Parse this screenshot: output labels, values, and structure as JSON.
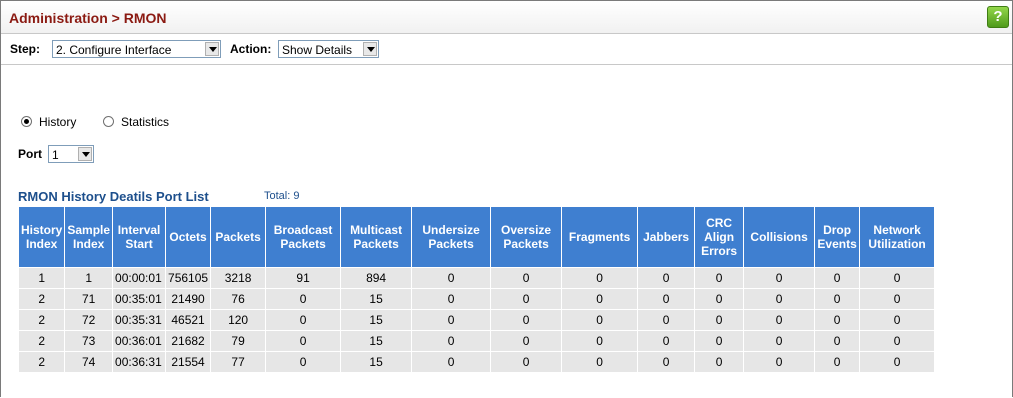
{
  "header": {
    "title": "Administration > RMON",
    "help_icon": "?"
  },
  "toolbar": {
    "step_label": "Step:",
    "step_value": "2. Configure Interface",
    "action_label": "Action:",
    "action_value": "Show Details"
  },
  "options": {
    "history_label": "History",
    "statistics_label": "Statistics",
    "selected": "History",
    "port_label": "Port",
    "port_value": "1"
  },
  "list": {
    "title": "RMON History Deatils Port List",
    "total": "Total: 9",
    "columns": [
      "History Index",
      "Sample Index",
      "Interval Start",
      "Octets",
      "Packets",
      "Broadcast Packets",
      "Multicast Packets",
      "Undersize Packets",
      "Oversize Packets",
      "Fragments",
      "Jabbers",
      "CRC Align Errors",
      "Collisions",
      "Drop Events",
      "Network Utilization"
    ],
    "rows": [
      [
        "1",
        "1",
        "00:00:01",
        "756105",
        "3218",
        "91",
        "894",
        "0",
        "0",
        "0",
        "0",
        "0",
        "0",
        "0",
        "0"
      ],
      [
        "2",
        "71",
        "00:35:01",
        "21490",
        "76",
        "0",
        "15",
        "0",
        "0",
        "0",
        "0",
        "0",
        "0",
        "0",
        "0"
      ],
      [
        "2",
        "72",
        "00:35:31",
        "46521",
        "120",
        "0",
        "15",
        "0",
        "0",
        "0",
        "0",
        "0",
        "0",
        "0",
        "0"
      ],
      [
        "2",
        "73",
        "00:36:01",
        "21682",
        "79",
        "0",
        "15",
        "0",
        "0",
        "0",
        "0",
        "0",
        "0",
        "0",
        "0"
      ],
      [
        "2",
        "74",
        "00:36:31",
        "21554",
        "77",
        "0",
        "15",
        "0",
        "0",
        "0",
        "0",
        "0",
        "0",
        "0",
        "0"
      ]
    ]
  }
}
